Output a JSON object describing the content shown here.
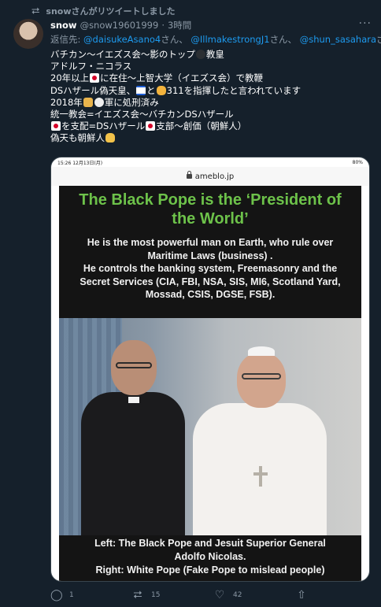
{
  "retweet": {
    "icon": "retweet-icon",
    "text": "snowさんがリツイートしました"
  },
  "tweet": {
    "author_name": "snow",
    "handle": "@snow19601999",
    "separator": "·",
    "time": "3時間",
    "more_icon": "more-icon",
    "reply_prefix": "返信先:",
    "reply_mentions": [
      {
        "handle": "@daisukeAsano4",
        "suffix": "さん、"
      },
      {
        "handle": "@IllmakestrongJ1",
        "suffix": "さん、"
      },
      {
        "handle": "@shun_sasahara",
        "suffix": "さん"
      }
    ],
    "lines": [
      {
        "pre": "バチカン〜イエズス会〜影のトップ",
        "emoji": "dark-circle-emoji",
        "post": "教皇"
      },
      {
        "pre": "アドルフ・ニコラス"
      },
      {
        "pre": "20年以上",
        "emoji": "japan-flag-emoji",
        "post": "に在住〜上智大学（イエズス会）で教鞭"
      },
      {
        "pre": "DSハザール偽天皇、",
        "emoji": "israel-flag-emoji",
        "mid": "と",
        "emoji2": "handshake-emoji",
        "post": "311を指揮したと言われています"
      },
      {
        "pre": "2018年",
        "emoji": "badge-emoji",
        "emoji2": "white-circle-emoji",
        "post": "軍に処刑済み"
      },
      {
        "pre": "統一教会=イエズス会〜バチカンDSハザール"
      },
      {
        "emoji": "japan-flag-emoji",
        "pre": "",
        "post": "を支配=DSハザール",
        "emoji2": "japan-flag-emoji",
        "post2": "支部〜創価（朝鮮人）"
      },
      {
        "pre": "偽天も朝鮮人",
        "emoji": "pray-emoji"
      }
    ]
  },
  "media": {
    "status_time": "15:26 12月13日(月)",
    "status_battery": "80%",
    "url": "ameblo.jp",
    "lock_icon": "lock-icon",
    "poster_title": [
      "The Black Pope is the ‘President of",
      "the World’"
    ],
    "poster_body": [
      "He is the most powerful man on Earth, who rule over",
      "Maritime Laws (business) .",
      "He controls the banking system, Freemasonry and the",
      "Secret Services (CIA, FBI, NSA, SIS, MI6, Scotland Yard,",
      "Mossad, CSIS, DGSE, FSB)."
    ],
    "caption": [
      "Left: The Black Pope and Jesuit Superior General",
      "Adolfo Nicolas.",
      "Right: White Pope (Fake Pope to mislead people)"
    ]
  },
  "actions": {
    "reply": {
      "icon": "reply-icon",
      "count": "1"
    },
    "retweet": {
      "icon": "retweet-icon",
      "count": "15"
    },
    "like": {
      "icon": "like-icon",
      "count": "42"
    },
    "share": {
      "icon": "share-icon"
    }
  },
  "colors": {
    "background": "#15202b",
    "text": "#ffffff",
    "muted": "#8b98a5",
    "link": "#1d9bf0",
    "poster_title": "#6dc24a"
  }
}
